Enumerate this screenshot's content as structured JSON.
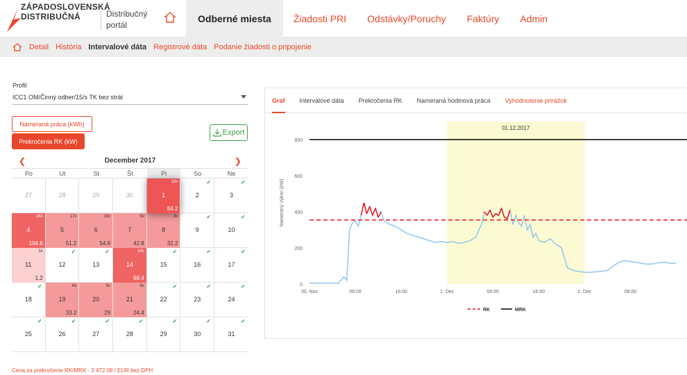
{
  "brand": {
    "line1": "ZÁPADOSLOVENSKÁ",
    "line2": "DISTRIBUČNÁ",
    "portal": "Distribučný portál",
    "accent": "#e8472b"
  },
  "nav": {
    "items": [
      {
        "label": "Odberné miesta",
        "active": true
      },
      {
        "label": "Žiadosti PRI"
      },
      {
        "label": "Odstávky/Poruchy"
      },
      {
        "label": "Faktúry"
      },
      {
        "label": "Admin"
      }
    ]
  },
  "subnav": {
    "items": [
      {
        "label": "Detail"
      },
      {
        "label": "História"
      },
      {
        "label": "Intervalové dáta",
        "active": true
      },
      {
        "label": "Registrové dáta"
      },
      {
        "label": "Podanie žiadosti o pripojenie"
      }
    ]
  },
  "profile": {
    "label": "Profil",
    "value": "ICC1 OM/Činný odber/15/s TK bez strát"
  },
  "buttons": {
    "work": "Nameraná práca (kWh)",
    "rk": "Prekročenia RK (kW)",
    "export": "Export"
  },
  "calendar": {
    "title": "December 2017",
    "weekdays": [
      "Po",
      "Ut",
      "St",
      "Št",
      "Pi",
      "So",
      "Ne"
    ],
    "weeks": [
      [
        {
          "d": "27",
          "other": true
        },
        {
          "d": "28",
          "other": true
        },
        {
          "d": "29",
          "other": true
        },
        {
          "d": "30",
          "other": true
        },
        {
          "d": "1",
          "cnt": "18x",
          "val": "84.2",
          "cls": "sel"
        },
        {
          "d": "2",
          "ok": true
        },
        {
          "d": "3",
          "ok": true
        }
      ],
      [
        {
          "d": "4",
          "cnt": "34x",
          "val": "104.6",
          "cls": "dark"
        },
        {
          "d": "5",
          "cnt": "17x",
          "val": "51.2",
          "cls": "mid"
        },
        {
          "d": "6",
          "cnt": "18x",
          "val": "54.6",
          "cls": "mid"
        },
        {
          "d": "7",
          "cnt": "5x",
          "val": "42.8",
          "cls": "mid"
        },
        {
          "d": "8",
          "cnt": "3x",
          "val": "32.2",
          "cls": "mid"
        },
        {
          "d": "9",
          "ok": true
        },
        {
          "d": "10",
          "ok": true
        }
      ],
      [
        {
          "d": "11",
          "cnt": "1x",
          "val": "1.2",
          "cls": "light"
        },
        {
          "d": "12",
          "ok": true
        },
        {
          "d": "13",
          "ok": true
        },
        {
          "d": "14",
          "cnt": "14x",
          "val": "68.4",
          "cls": "dark"
        },
        {
          "d": "15",
          "ok": true
        },
        {
          "d": "16",
          "ok": true
        },
        {
          "d": "17",
          "ok": true
        }
      ],
      [
        {
          "d": "18",
          "ok": true
        },
        {
          "d": "19",
          "cnt": "6x",
          "val": "33.2",
          "cls": "mid"
        },
        {
          "d": "20",
          "cnt": "5x",
          "val": "29",
          "cls": "mid"
        },
        {
          "d": "21",
          "cnt": "6x",
          "val": "24.4",
          "cls": "mid"
        },
        {
          "d": "22",
          "ok": true
        },
        {
          "d": "23",
          "ok": true
        },
        {
          "d": "24",
          "ok": true
        }
      ],
      [
        {
          "d": "25",
          "ok": true
        },
        {
          "d": "26",
          "ok": true
        },
        {
          "d": "27",
          "ok": true
        },
        {
          "d": "28",
          "ok": true
        },
        {
          "d": "29",
          "ok": true
        },
        {
          "d": "30",
          "ok": true
        },
        {
          "d": "31",
          "ok": true
        }
      ]
    ]
  },
  "price_note": "Cena za prekročenie RK/MRK - 3 472.08 / EUR bez DPH",
  "chart_tabs": [
    {
      "label": "Graf",
      "active": true
    },
    {
      "label": "Intervalové dáta"
    },
    {
      "label": "Prekročenia RK"
    },
    {
      "label": "Nameraná hodinová práca"
    },
    {
      "label": "Vyhodnotenie prirážok",
      "red": true
    }
  ],
  "chart_data": {
    "type": "line",
    "ylabel": "Nameraný výkon (kW)",
    "ylim": [
      0,
      900
    ],
    "yticks": [
      0,
      200,
      400,
      600,
      800
    ],
    "x_start": "30. Nov 00:00",
    "x_tick_labels": [
      "30. Nov",
      "08:00",
      "16:00",
      "1. Dec",
      "08:00",
      "16:00",
      "2. Dec",
      "08:00"
    ],
    "x_tick_hours": [
      0,
      8,
      16,
      24,
      32,
      40,
      48,
      56
    ],
    "xlim_hours": [
      0,
      66
    ],
    "highlight": {
      "label": "01.12.2017",
      "from_hour": 24,
      "to_hour": 48,
      "color": "#fbfad2"
    },
    "mrk": 800,
    "rk": 355,
    "legend": [
      {
        "name": "RK",
        "color": "#e8121e",
        "dash": true
      },
      {
        "name": "MRK",
        "color": "#000000",
        "dash": false
      }
    ],
    "series_color": "#90c6ee",
    "over_color": "#e8121e",
    "series_hours": [
      0,
      1,
      2,
      3,
      4,
      5,
      6,
      6.5,
      7,
      7.5,
      8,
      8.5,
      9,
      9.5,
      10,
      10.5,
      11,
      11.5,
      12,
      12.5,
      13,
      13.5,
      14,
      15,
      16,
      17,
      18,
      19,
      20,
      21,
      22,
      23,
      24,
      25,
      26,
      27,
      28,
      29,
      30,
      30.5,
      31,
      31.5,
      32,
      32.5,
      33,
      33.5,
      34,
      34.5,
      35,
      35.5,
      36,
      36.5,
      37,
      37.5,
      38,
      38.5,
      39,
      39.5,
      40,
      41,
      42,
      43,
      44,
      45,
      46,
      47,
      47.5,
      48,
      49,
      50,
      51,
      52,
      53,
      54,
      55,
      56,
      57,
      58,
      59,
      60,
      61,
      62,
      63,
      64,
      65,
      66
    ],
    "series_values": [
      5,
      5,
      5,
      5,
      5,
      5,
      40,
      20,
      300,
      340,
      350,
      320,
      380,
      450,
      390,
      430,
      380,
      420,
      370,
      400,
      350,
      340,
      330,
      320,
      300,
      280,
      270,
      260,
      250,
      240,
      230,
      235,
      230,
      235,
      225,
      230,
      240,
      260,
      330,
      400,
      380,
      410,
      370,
      390,
      380,
      420,
      370,
      360,
      410,
      330,
      380,
      340,
      320,
      380,
      300,
      330,
      260,
      280,
      240,
      230,
      250,
      220,
      200,
      90,
      75,
      70,
      68,
      65,
      65,
      68,
      70,
      75,
      100,
      120,
      130,
      125,
      120,
      115,
      110,
      112,
      118,
      120,
      115,
      115
    ]
  }
}
